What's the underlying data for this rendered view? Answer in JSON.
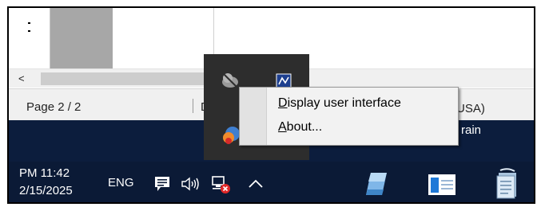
{
  "statusbar": {
    "page_text": "Page 2 / 2",
    "fragment_text": "D",
    "language_text": "USA)"
  },
  "band": {
    "text": "rain"
  },
  "scrollbar": {
    "left_arrow": "<"
  },
  "taskbar": {
    "time": "PM 11:42",
    "date": "2/15/2025",
    "input_language": "ENG"
  },
  "context_menu": {
    "items": [
      {
        "underlined": "D",
        "rest": "isplay user interface"
      },
      {
        "underlined": "A",
        "rest": "bout..."
      }
    ]
  },
  "colors": {
    "taskbar_bg": "#0b1a36",
    "flyout_bg": "#2d2d2d",
    "menu_bg": "#f2f2f2",
    "accent_blue": "#1e78d7"
  },
  "icons": {
    "tray": [
      "gray-cloud-icon",
      "blue-app-icon",
      "colorful-app-icon"
    ],
    "system": [
      "message-icon",
      "volume-icon",
      "network-error-icon",
      "show-hidden-icons-icon"
    ],
    "pinned": [
      "notepad-app-icon",
      "window-app-icon",
      "document-stack-icon"
    ]
  }
}
